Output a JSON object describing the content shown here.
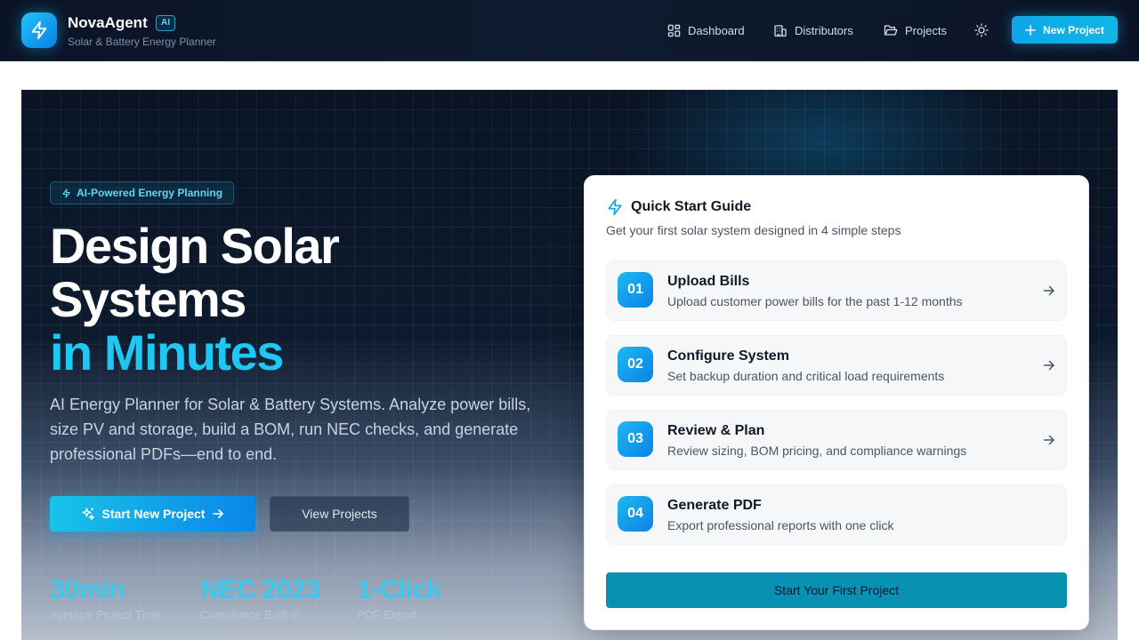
{
  "brand": {
    "name": "NovaAgent",
    "badge": "AI",
    "subtitle": "Solar & Battery Energy Planner",
    "logo_icon": "lightning-bolt-icon"
  },
  "nav": {
    "items": [
      {
        "label": "Dashboard",
        "icon": "grid-icon"
      },
      {
        "label": "Distributors",
        "icon": "building-icon"
      },
      {
        "label": "Projects",
        "icon": "folder-icon"
      }
    ],
    "theme_toggle_icon": "sun-icon",
    "new_project_label": "New Project"
  },
  "hero": {
    "pill": "AI-Powered Energy Planning",
    "headline_line1": "Design Solar",
    "headline_line2": "Systems",
    "headline_line3": "in Minutes",
    "description": "AI Energy Planner for Solar & Battery Systems. Analyze power bills, size PV and storage, build a BOM, run NEC checks, and generate professional PDFs—end to end.",
    "primary_cta": "Start New Project",
    "secondary_cta": "View Projects",
    "stats": [
      {
        "value": "30min",
        "label": "Average Project Time"
      },
      {
        "value": "NEC 2023",
        "label": "Compliance Built-in"
      },
      {
        "value": "1-Click",
        "label": "PDF Export"
      }
    ]
  },
  "quick_start": {
    "title": "Quick Start Guide",
    "subtitle": "Get your first solar system designed in 4 simple steps",
    "steps": [
      {
        "number": "01",
        "title": "Upload Bills",
        "description": "Upload customer power bills for the past 1-12 months"
      },
      {
        "number": "02",
        "title": "Configure System",
        "description": "Set backup duration and critical load requirements"
      },
      {
        "number": "03",
        "title": "Review & Plan",
        "description": "Review sizing, BOM pricing, and compliance warnings"
      },
      {
        "number": "04",
        "title": "Generate PDF",
        "description": "Export professional reports with one click"
      }
    ],
    "button_label": "Start Your First Project"
  },
  "colors": {
    "accent": "#0ea5e9",
    "accent_text": "#1ec8f4",
    "nav_bg": "#0b1426",
    "cta_button": "#0891b2"
  }
}
